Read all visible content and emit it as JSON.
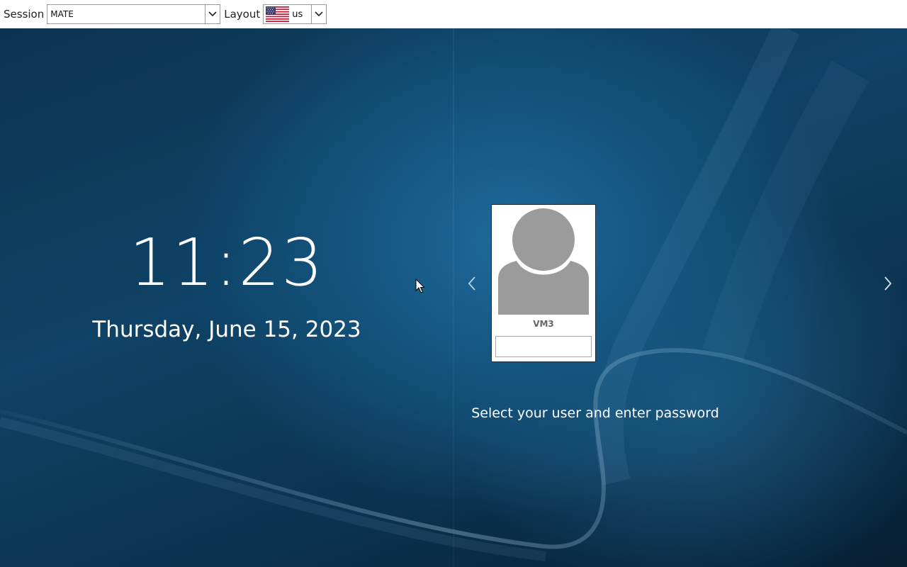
{
  "topbar": {
    "session_label": "Session",
    "session_value": "MATE",
    "layout_label": "Layout",
    "layout_value": "us",
    "layout_flag_icon": "us-flag-icon"
  },
  "greeter": {
    "clock_time": "11:23",
    "date": "Thursday, June 15, 2023",
    "prev_user_icon": "chevron-left-icon",
    "next_user_icon": "chevron-right-icon",
    "user": {
      "name": "VM3",
      "avatar_icon": "user-avatar-icon",
      "password_value": ""
    },
    "prompt": "Select your user and enter password"
  },
  "colors": {
    "background_dark": "#0b3350",
    "background_light": "#1e6a9c",
    "avatar_gray": "#9b9b9b"
  }
}
